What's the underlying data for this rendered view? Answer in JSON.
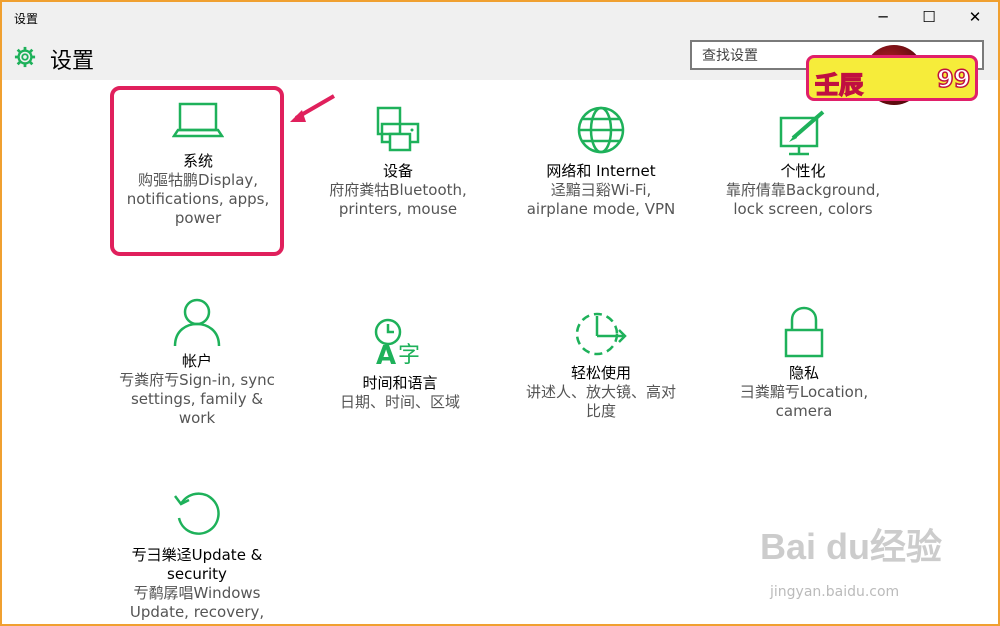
{
  "window": {
    "title": "设置"
  },
  "window_controls": {
    "minimize": "─",
    "maximize": "☐",
    "close": "✕"
  },
  "header": {
    "title": "设置",
    "search_placeholder": "查找设置"
  },
  "watermark": {
    "left": "壬辰",
    "right": "99"
  },
  "accent_color": "#1eb15a",
  "tiles": [
    {
      "icon": "laptop-icon",
      "name": "系统",
      "desc": [
        "购彄牯鹏Display,",
        "notifications, apps,",
        "power"
      ]
    },
    {
      "icon": "printer-icon",
      "name": "设备",
      "desc": [
        "府府粪牯Bluetooth,",
        "printers, mouse"
      ]
    },
    {
      "icon": "globe-icon",
      "name": "网络和 Internet",
      "desc": [
        "迳黯彐谿Wi-Fi,",
        "airplane mode, VPN"
      ]
    },
    {
      "icon": "personalization-icon",
      "name": "个性化",
      "desc": [
        "靠府倩靠Background,",
        "lock screen, colors"
      ]
    },
    {
      "icon": "person-icon",
      "name": "帐户",
      "desc": [
        "亐粪府亐Sign-in, sync",
        "settings, family &",
        "work"
      ]
    },
    {
      "icon": "clock-language-icon",
      "name": "时间和语言",
      "desc": [
        "日期、时间、区域"
      ]
    },
    {
      "icon": "ease-of-access-icon",
      "name": "轻松使用",
      "desc": [
        "讲述人、放大镜、高对",
        "比度"
      ]
    },
    {
      "icon": "lock-icon",
      "name": "隐私",
      "desc": [
        "彐粪黯亐Location,",
        "camera"
      ]
    },
    {
      "icon": "update-icon",
      "name": "亐彐樂迳Update &",
      "desc": [
        "security",
        "亐鹬孱唱Windows",
        "Update, recovery,"
      ]
    }
  ],
  "baidu_watermark": {
    "text": "Bai du经验",
    "url": "jingyan.baidu.com"
  }
}
